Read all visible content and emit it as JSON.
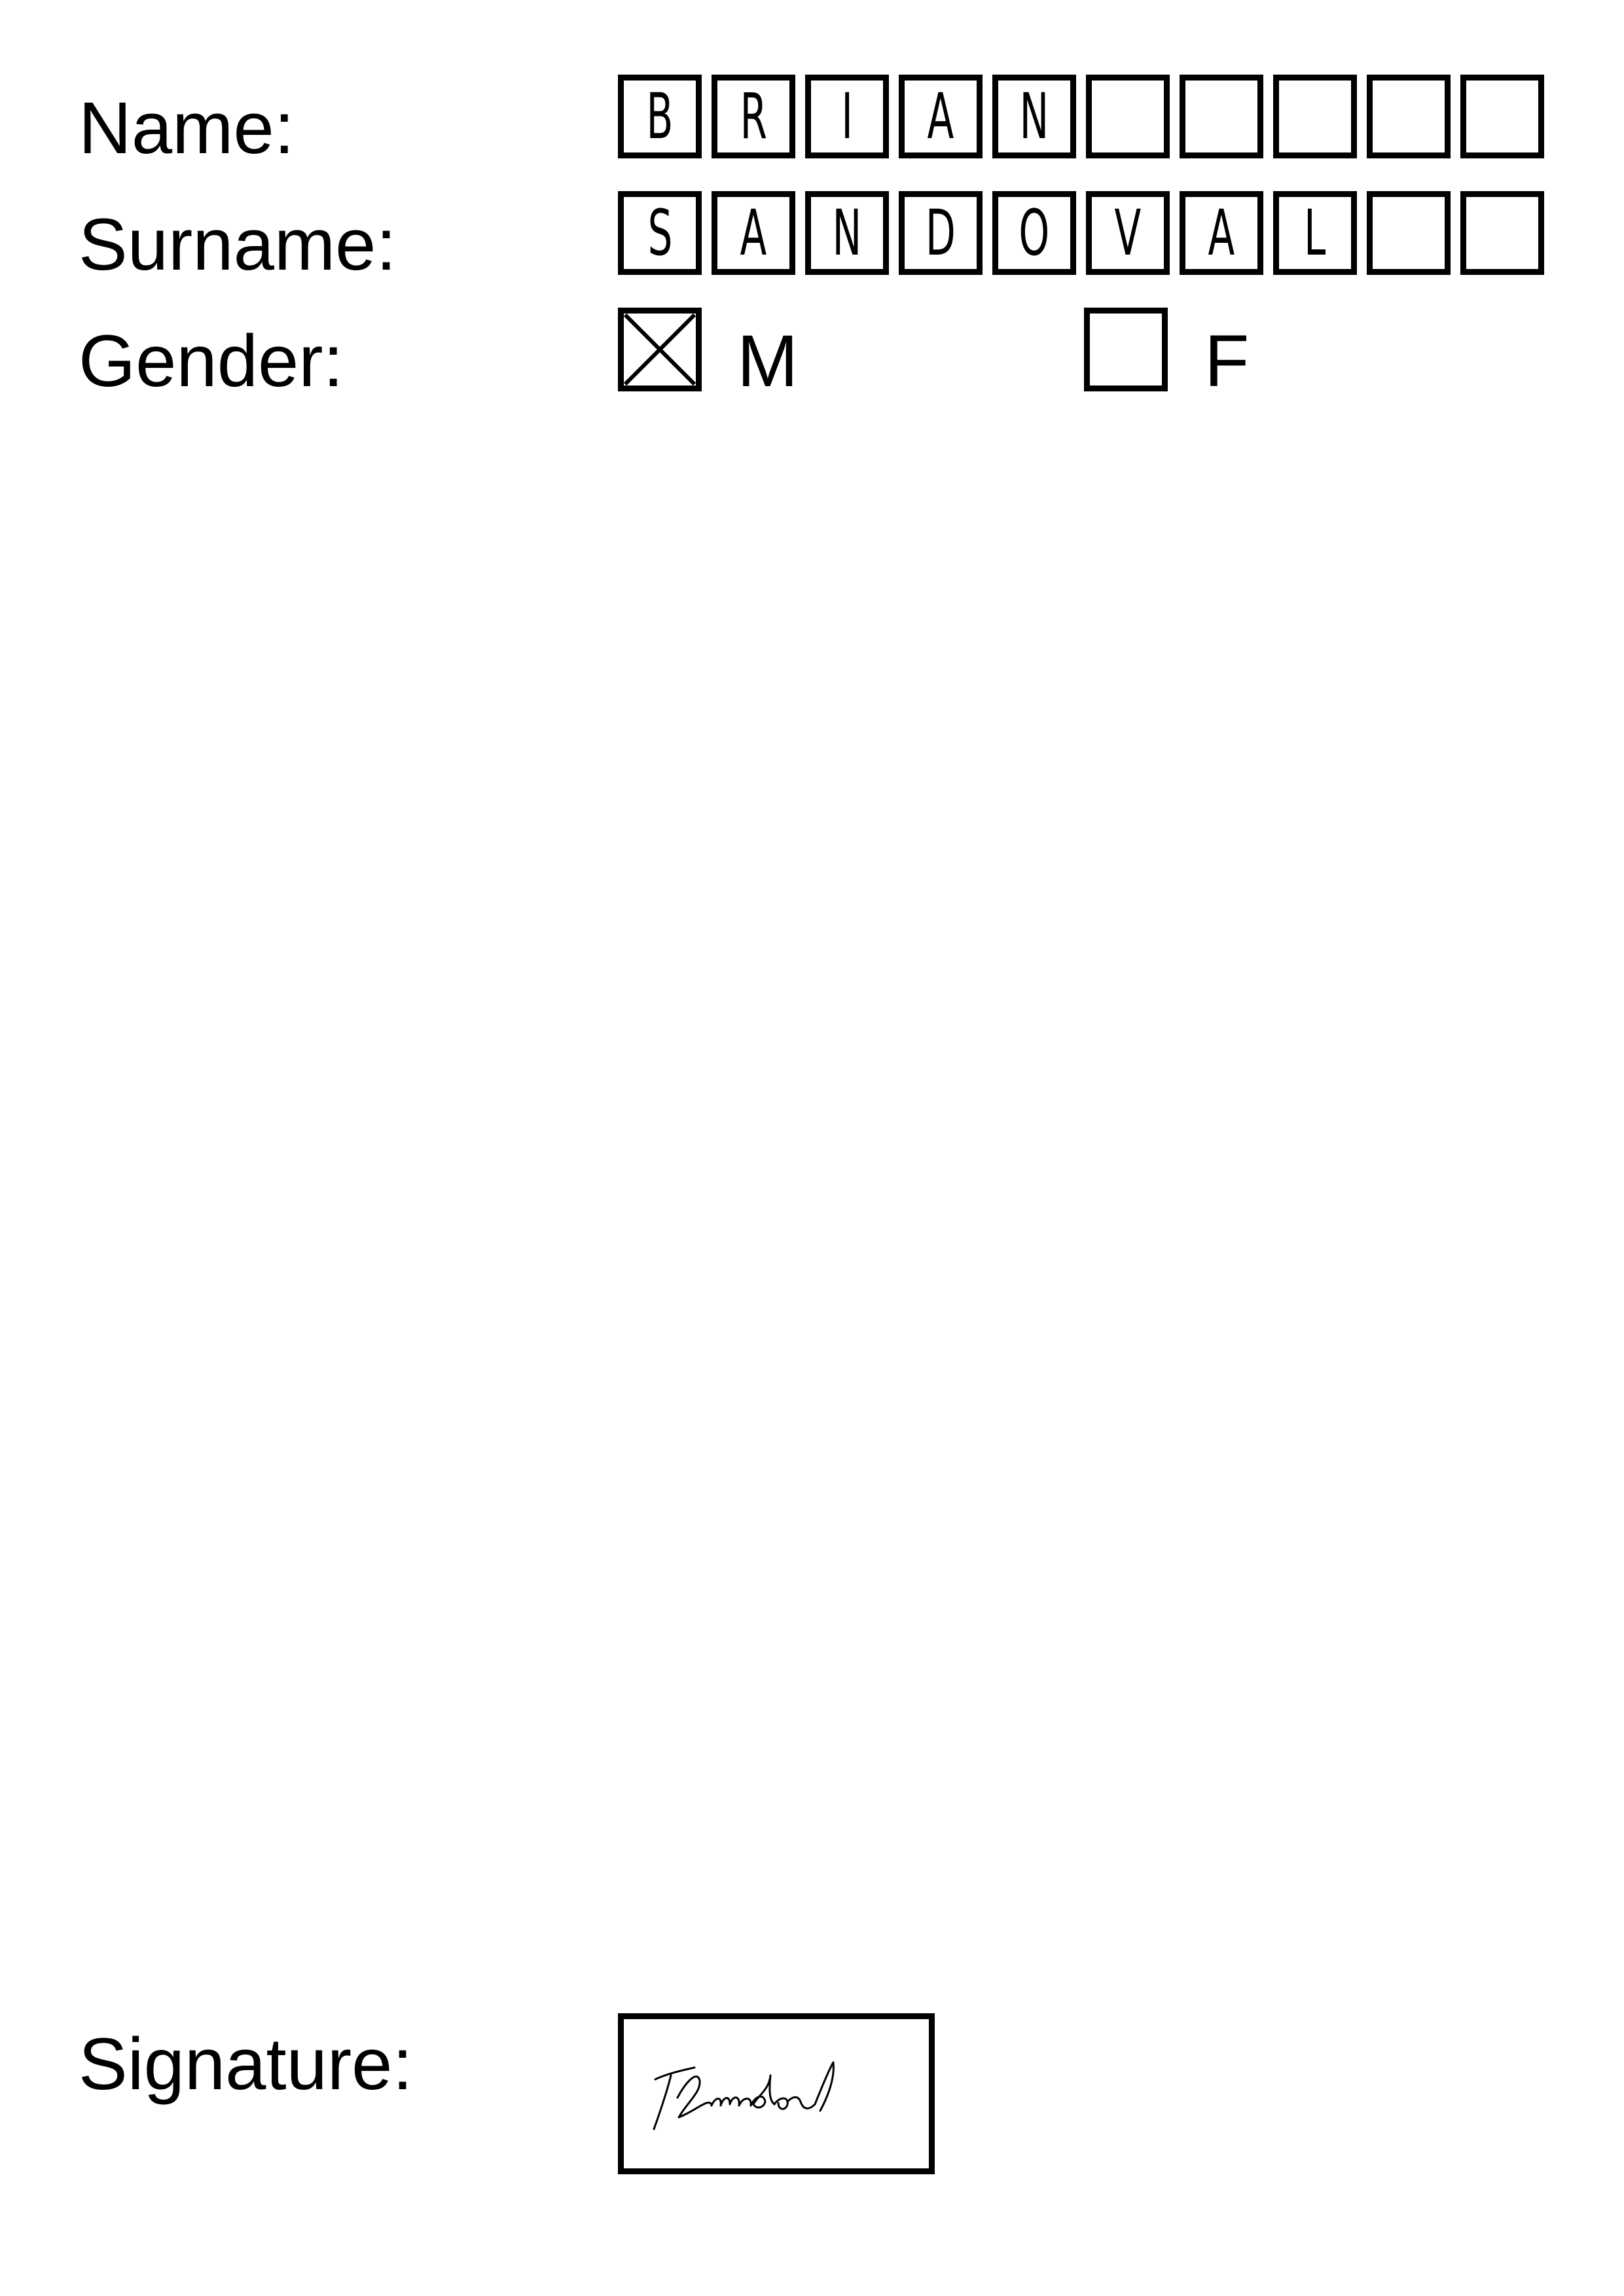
{
  "form": {
    "name_label": "Name:",
    "surname_label": "Surname:",
    "gender_label": "Gender:",
    "signature_label": "Signature:"
  },
  "name_chars": [
    "B",
    "R",
    "I",
    "A",
    "N",
    "",
    "",
    "",
    "",
    ""
  ],
  "surname_chars": [
    "S",
    "A",
    "N",
    "D",
    "O",
    "V",
    "A",
    "L",
    "",
    ""
  ],
  "gender": {
    "options": [
      {
        "label": "M",
        "checked": true
      },
      {
        "label": "F",
        "checked": false
      }
    ]
  },
  "signature": {
    "text": "B Sandoval"
  }
}
